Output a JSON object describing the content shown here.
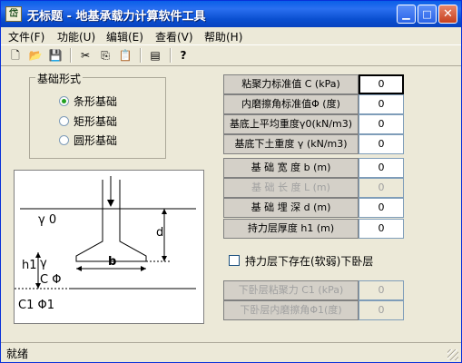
{
  "window": {
    "title": "无标题 - 地基承载力计算软件工具",
    "app_icon_text": "岱"
  },
  "menu": [
    "文件(F)",
    "功能(U)",
    "编辑(E)",
    "查看(V)",
    "帮助(H)"
  ],
  "toolbar": [
    {
      "name": "new-file-icon",
      "glyph": "🗋"
    },
    {
      "name": "open-folder-icon",
      "glyph": "📂"
    },
    {
      "name": "save-icon",
      "glyph": "💾"
    },
    {
      "name": "cut-icon",
      "glyph": "✂"
    },
    {
      "name": "copy-icon",
      "glyph": "⎘"
    },
    {
      "name": "paste-icon",
      "glyph": "📋"
    },
    {
      "name": "calculate-icon",
      "glyph": "▤"
    },
    {
      "name": "help-icon",
      "glyph": "?"
    }
  ],
  "foundation_type": {
    "title": "基础形式",
    "options": [
      "条形基础",
      "矩形基础",
      "圆形基础"
    ],
    "selected": "条形基础"
  },
  "diagram": {
    "gamma0": "γ 0",
    "d": "d",
    "h1": "h1",
    "gamma": "γ",
    "c_phi": "C  Φ",
    "b": "b",
    "c1_phi1": "C1  Φ1"
  },
  "params": [
    {
      "label": "粘聚力标准值 C  (kPa)",
      "value": "0",
      "enabled": true
    },
    {
      "label": "内磨擦角标准值Φ (度)",
      "value": "0",
      "enabled": true
    },
    {
      "label": "基底上平均重度γ0(kN/m3)",
      "value": "0",
      "enabled": true
    },
    {
      "label": "基底下土重度 γ (kN/m3)",
      "value": "0",
      "enabled": true
    },
    {
      "label": "基 础 宽 度 b  (m)",
      "value": "0",
      "enabled": true
    },
    {
      "label": "基 础 长 度 L  (m)",
      "value": "0",
      "enabled": false
    },
    {
      "label": "基 础 埋 深 d  (m)",
      "value": "0",
      "enabled": true
    },
    {
      "label": "持力层厚度 h1  (m)",
      "value": "0",
      "enabled": true
    }
  ],
  "weak_layer_checkbox": "持力层下存在(软弱)下卧层",
  "weak_params": [
    {
      "label": "下卧层粘聚力 C1 (kPa)",
      "value": "0"
    },
    {
      "label": "下卧层内磨擦角Φ1(度)",
      "value": "0"
    }
  ],
  "status": "就绪"
}
